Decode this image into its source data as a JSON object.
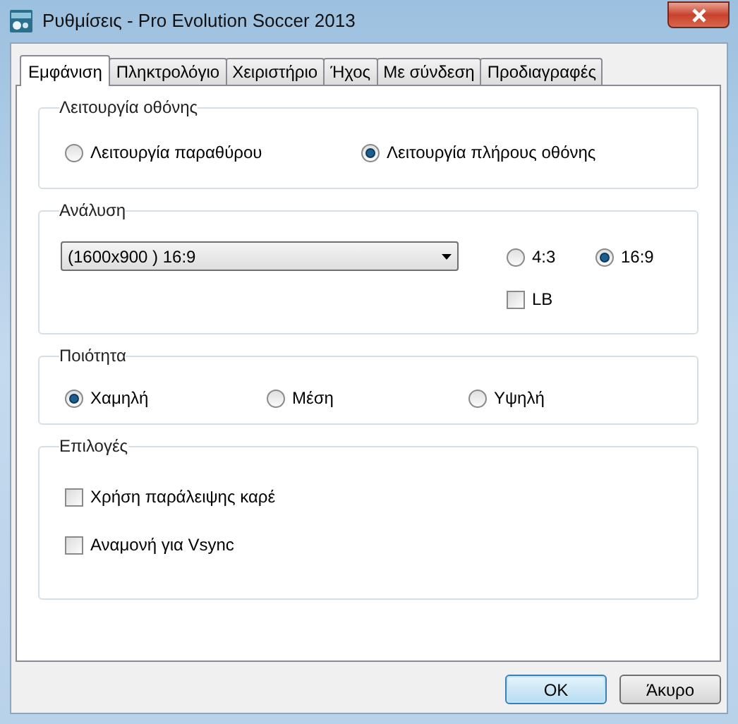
{
  "window": {
    "title": "Ρυθμίσεις - Pro Evolution Soccer 2013"
  },
  "tabs": [
    {
      "label": "Εμφάνιση",
      "selected": true
    },
    {
      "label": "Πληκτρολόγιο",
      "selected": false
    },
    {
      "label": "Χειριστήριο",
      "selected": false
    },
    {
      "label": "Ήχος",
      "selected": false
    },
    {
      "label": "Με σύνδεση",
      "selected": false
    },
    {
      "label": "Προδιαγραφές",
      "selected": false
    }
  ],
  "display_mode": {
    "title": "Λειτουργία οθόνης",
    "options": [
      {
        "label": "Λειτουργία παραθύρου",
        "selected": false
      },
      {
        "label": "Λειτουργία πλήρους οθόνης",
        "selected": true
      }
    ]
  },
  "resolution": {
    "title": "Ανάλυση",
    "dropdown": {
      "value": "(1600x900 ) 16:9"
    },
    "aspect": [
      {
        "label": "4:3",
        "selected": false
      },
      {
        "label": "16:9",
        "selected": true
      }
    ],
    "lb": {
      "label": "LB",
      "checked": false
    }
  },
  "quality": {
    "title": "Ποιότητα",
    "options": [
      {
        "label": "Χαμηλή",
        "selected": true
      },
      {
        "label": "Μέση",
        "selected": false
      },
      {
        "label": "Υψηλή",
        "selected": false
      }
    ]
  },
  "options": {
    "title": "Επιλογές",
    "checkboxes": [
      {
        "label": "Χρήση παράλειψης καρέ",
        "checked": false
      },
      {
        "label": "Αναμονή για Vsync",
        "checked": false
      }
    ]
  },
  "buttons": [
    {
      "label": "OK",
      "default": true
    },
    {
      "label": "Άκυρο",
      "default": false
    }
  ]
}
